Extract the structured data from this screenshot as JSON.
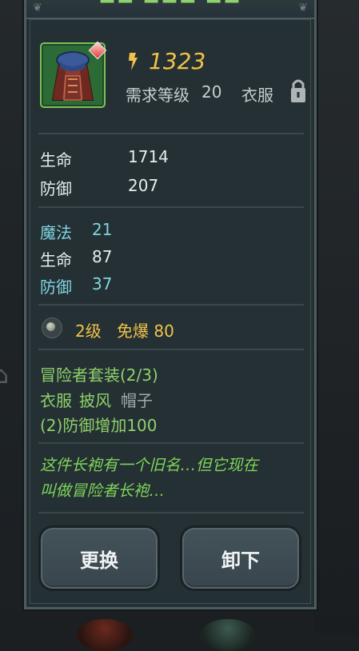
{
  "item": {
    "price": "1323",
    "required_level_label": "需求等级",
    "required_level": "20",
    "slot": "衣服"
  },
  "base_stats": [
    {
      "label": "生命",
      "value": "1714"
    },
    {
      "label": "防御",
      "value": "207"
    }
  ],
  "bonus_stats": [
    {
      "label": "魔法",
      "value": "21",
      "color": "#7fd4e2"
    },
    {
      "label": "生命",
      "value": "87",
      "color": "#e8ecec"
    },
    {
      "label": "防御",
      "value": "37",
      "color": "#7fd4e2"
    }
  ],
  "gem": {
    "level": "2级",
    "effect": "免爆 80"
  },
  "set": {
    "name": "冒险者套装(2/3)",
    "pieces_owned": [
      "衣服",
      "披风"
    ],
    "pieces_missing": [
      "帽子"
    ],
    "bonus": "(2)防御增加100"
  },
  "flavor_lines": [
    "这件长袍有一个旧名…但它现在",
    "叫做冒险者长袍…"
  ],
  "buttons": {
    "replace": "更换",
    "unequip": "卸下"
  },
  "colors": {
    "panel": "#243034",
    "gold": "#f0c24a",
    "green": "#8fd16a",
    "cyan": "#7fd4e2",
    "rarity_border": "#7dbf5a"
  }
}
